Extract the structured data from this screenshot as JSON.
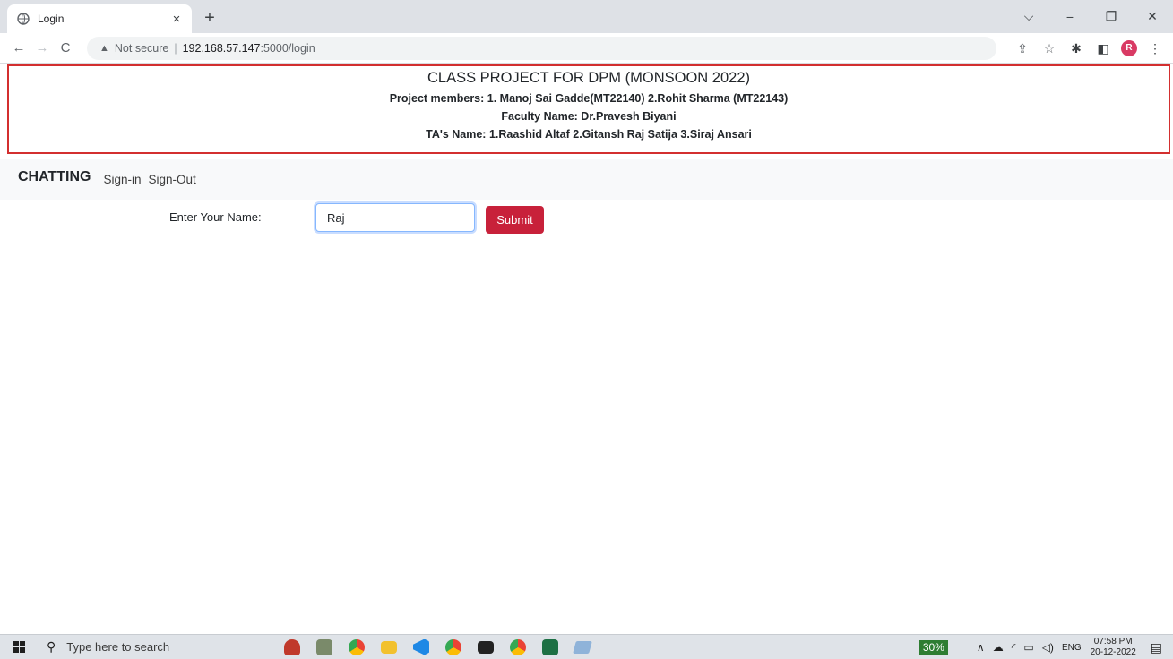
{
  "browser": {
    "tab": {
      "title": "Login",
      "close_glyph": "×"
    },
    "new_tab_glyph": "+",
    "window_controls": {
      "dropdown": "⌵",
      "minimize": "−",
      "restore": "❐",
      "close": "✕"
    },
    "nav": {
      "back": "←",
      "forward": "→",
      "reload": "C"
    },
    "address": {
      "security_label": "Not secure",
      "separator": "|",
      "host": "192.168.57.147",
      "path": ":5000/login"
    },
    "toolbar_icons": [
      "share-icon",
      "star-icon",
      "extensions-icon",
      "side-panel-icon",
      "profile-avatar",
      "menu-icon"
    ],
    "profile_initial": "R"
  },
  "banner": {
    "title": "CLASS PROJECT FOR DPM (MONSOON 2022)",
    "members": "Project members: 1. Manoj Sai Gadde(MT22140) 2.Rohit Sharma (MT22143)",
    "faculty": "Faculty Name: Dr.Pravesh Biyani",
    "tas": "TA's Name: 1.Raashid Altaf 2.Gitansh Raj Satija 3.Siraj Ansari",
    "border_color": "#d32f2f"
  },
  "navbar": {
    "brand": "CHATTING",
    "links": [
      "Sign-in",
      "Sign-Out"
    ]
  },
  "form": {
    "label": "Enter Your Name:",
    "name_value": "Raj",
    "submit_label": "Submit",
    "submit_color": "#c8213a"
  },
  "taskbar": {
    "search_placeholder": "Type here to search",
    "apps": [
      "pinned-app-1",
      "pinned-app-2",
      "chrome-icon",
      "file-explorer-icon",
      "vscode-icon",
      "chrome-profile-icon",
      "terminal-icon",
      "chrome-icon-2",
      "excel-icon",
      "app-icon"
    ],
    "battery": "30%",
    "language": "ENG",
    "time": "07:58 PM",
    "date": "20-12-2022"
  }
}
